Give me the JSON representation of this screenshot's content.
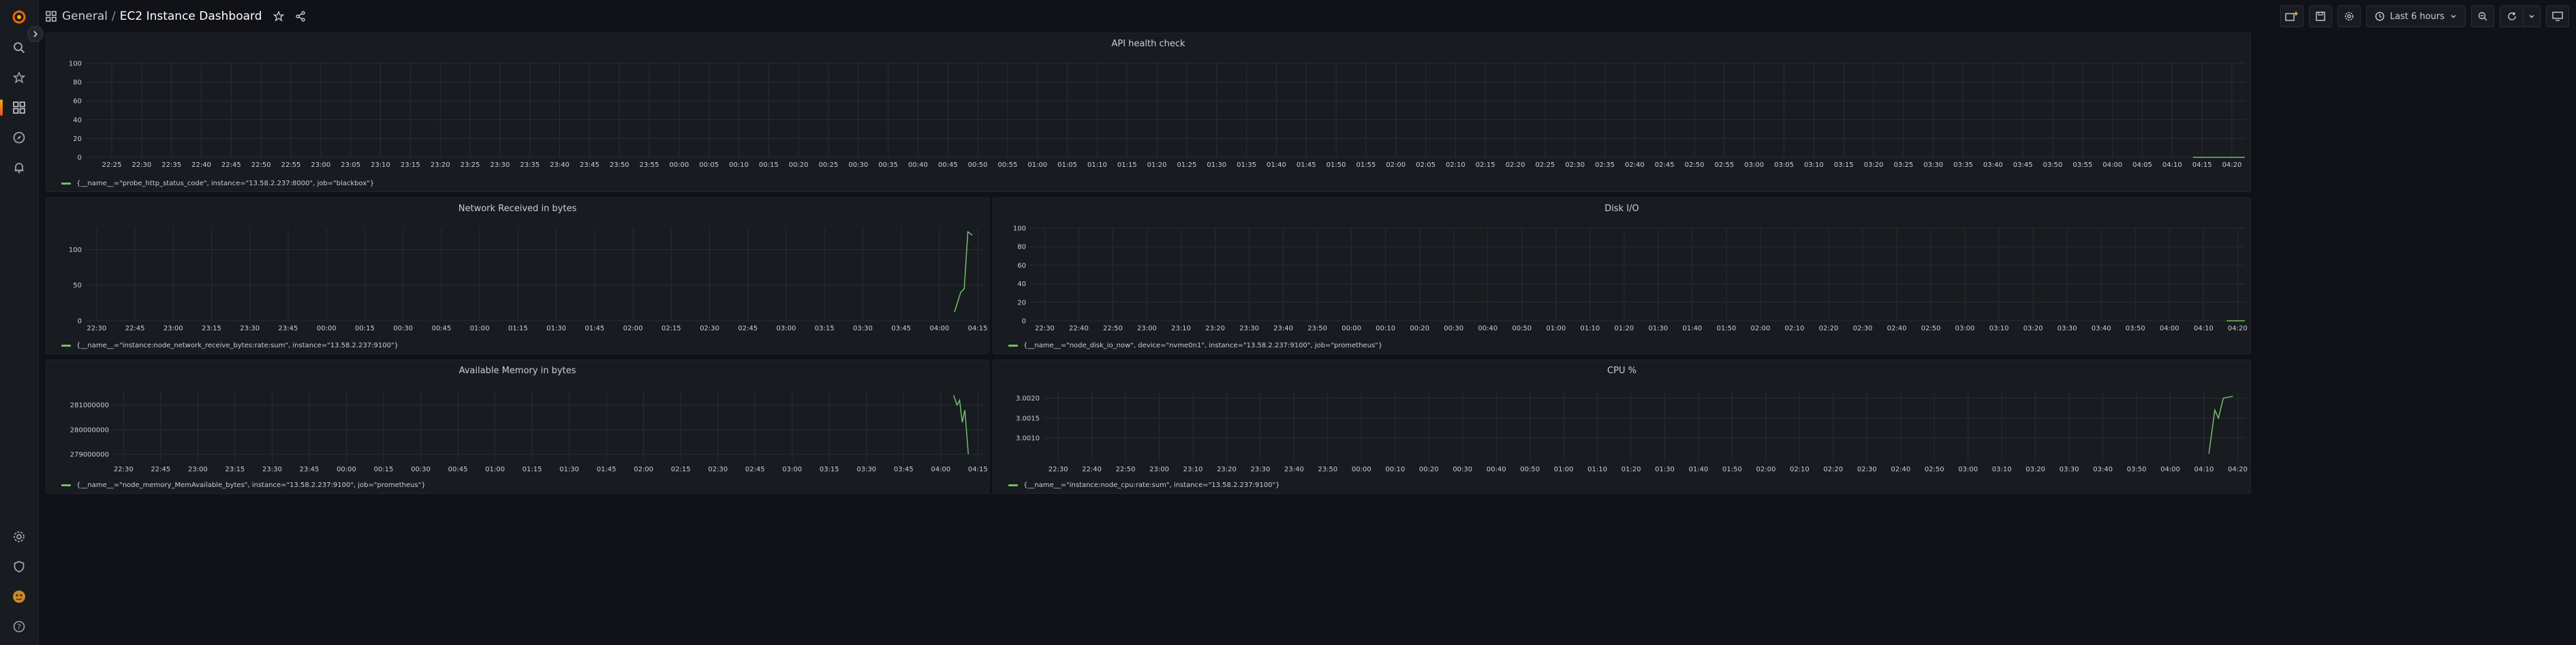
{
  "sidebar": {
    "items": [
      {
        "name": "grafana-logo-icon"
      },
      {
        "name": "search-icon"
      },
      {
        "name": "starred-icon"
      },
      {
        "name": "dashboards-icon"
      },
      {
        "name": "explore-icon"
      },
      {
        "name": "alerting-icon"
      },
      {
        "name": "configuration-icon"
      },
      {
        "name": "server-admin-icon"
      },
      {
        "name": "profile-avatar-icon"
      },
      {
        "name": "help-icon"
      }
    ]
  },
  "breadcrumb": {
    "folder": "General",
    "separator": "/",
    "dashboard": "EC2 Instance Dashboard"
  },
  "toolbar": {
    "time_range": "Last 6 hours"
  },
  "panels": {
    "api": {
      "title": "API health check",
      "legend": "{__name__=\"probe_http_status_code\", instance=\"13.58.2.237:8000\", job=\"blackbox\"}"
    },
    "network": {
      "title": "Network Received in bytes",
      "legend": "{__name__=\"instance:node_network_receive_bytes:rate:sum\", instance=\"13.58.2.237:9100\"}"
    },
    "disk": {
      "title": "Disk I/O",
      "legend": "{__name__=\"node_disk_io_now\", device=\"nvme0n1\", instance=\"13.58.2.237:9100\", job=\"prometheus\"}"
    },
    "memory": {
      "title": "Available Memory in bytes",
      "legend": "{__name__=\"node_memory_MemAvailable_bytes\", instance=\"13.58.2.237:9100\", job=\"prometheus\"}"
    },
    "cpu": {
      "title": "CPU %",
      "legend": "{__name__=\"instance:node_cpu:rate:sum\", instance=\"13.58.2.237:9100\"}"
    }
  },
  "chart_data": [
    {
      "id": "api",
      "type": "line",
      "title": "API health check",
      "yticks": [
        "100",
        "80",
        "60",
        "40",
        "20",
        "0"
      ],
      "ylim": [
        0,
        100
      ],
      "xticks": [
        "22:25",
        "22:30",
        "22:35",
        "22:40",
        "22:45",
        "22:50",
        "22:55",
        "23:00",
        "23:05",
        "23:10",
        "23:15",
        "23:20",
        "23:25",
        "23:30",
        "23:35",
        "23:40",
        "23:45",
        "23:50",
        "23:55",
        "00:00",
        "00:05",
        "00:10",
        "00:15",
        "00:20",
        "00:25",
        "00:30",
        "00:35",
        "00:40",
        "00:45",
        "00:50",
        "00:55",
        "01:00",
        "01:05",
        "01:10",
        "01:15",
        "01:20",
        "01:25",
        "01:30",
        "01:35",
        "01:40",
        "01:45",
        "01:50",
        "01:55",
        "02:00",
        "02:05",
        "02:10",
        "02:15",
        "02:20",
        "02:25",
        "02:30",
        "02:35",
        "02:40",
        "02:45",
        "02:50",
        "02:55",
        "03:00",
        "03:05",
        "03:10",
        "03:15",
        "03:20",
        "03:25",
        "03:30",
        "03:35",
        "03:40",
        "03:45",
        "03:50",
        "03:55",
        "04:00",
        "04:05",
        "04:10",
        "04:15",
        "04:20"
      ],
      "series": [
        {
          "color": "#73bf69",
          "points": [
            [
              0.976,
              0.0
            ],
            [
              1.0,
              0.0
            ]
          ]
        }
      ]
    },
    {
      "id": "network",
      "type": "line",
      "title": "Network Received in bytes",
      "yticks": [
        "100",
        "50",
        "0"
      ],
      "ylim": [
        0,
        130
      ],
      "xticks": [
        "22:30",
        "22:45",
        "23:00",
        "23:15",
        "23:30",
        "23:45",
        "00:00",
        "00:15",
        "00:30",
        "00:45",
        "01:00",
        "01:15",
        "01:30",
        "01:45",
        "02:00",
        "02:15",
        "02:30",
        "02:45",
        "03:00",
        "03:15",
        "03:30",
        "03:45",
        "04:00",
        "04:15"
      ],
      "series": [
        {
          "color": "#73bf69",
          "points": [
            [
              0.968,
              12
            ],
            [
              0.975,
              40
            ],
            [
              0.979,
              45
            ],
            [
              0.983,
              125
            ],
            [
              0.988,
              120
            ]
          ]
        }
      ]
    },
    {
      "id": "disk",
      "type": "line",
      "title": "Disk I/O",
      "yticks": [
        "100",
        "80",
        "60",
        "40",
        "20",
        "0"
      ],
      "ylim": [
        0,
        100
      ],
      "xticks": [
        "22:30",
        "22:40",
        "22:50",
        "23:00",
        "23:10",
        "23:20",
        "23:30",
        "23:40",
        "23:50",
        "00:00",
        "00:10",
        "00:20",
        "00:30",
        "00:40",
        "00:50",
        "01:00",
        "01:10",
        "01:20",
        "01:30",
        "01:40",
        "01:50",
        "02:00",
        "02:10",
        "02:20",
        "02:30",
        "02:40",
        "02:50",
        "03:00",
        "03:10",
        "03:20",
        "03:30",
        "03:40",
        "03:50",
        "04:00",
        "04:10",
        "04:20"
      ],
      "series": [
        {
          "color": "#73bf69",
          "points": [
            [
              0.985,
              0
            ],
            [
              1.0,
              0
            ]
          ]
        }
      ]
    },
    {
      "id": "memory",
      "type": "line",
      "title": "Available Memory in bytes",
      "yticks": [
        "281000000",
        "280000000",
        "279000000"
      ],
      "ylim": [
        278700000,
        281600000
      ],
      "xticks": [
        "22:30",
        "22:45",
        "23:00",
        "23:15",
        "23:30",
        "23:45",
        "00:00",
        "00:15",
        "00:30",
        "00:45",
        "01:00",
        "01:15",
        "01:30",
        "01:45",
        "02:00",
        "02:15",
        "02:30",
        "02:45",
        "03:00",
        "03:15",
        "03:30",
        "03:45",
        "04:00",
        "04:15"
      ],
      "series": [
        {
          "color": "#73bf69",
          "points": [
            [
              0.966,
              281400000
            ],
            [
              0.97,
              281000000
            ],
            [
              0.973,
              281200000
            ],
            [
              0.976,
              280300000
            ],
            [
              0.979,
              280800000
            ],
            [
              0.983,
              279000000
            ]
          ]
        }
      ]
    },
    {
      "id": "cpu",
      "type": "line",
      "title": "CPU %",
      "yticks": [
        "3.0020",
        "3.0015",
        "3.0010"
      ],
      "ylim": [
        3.0004,
        3.0022
      ],
      "xticks": [
        "22:30",
        "22:40",
        "22:50",
        "23:00",
        "23:10",
        "23:20",
        "23:30",
        "23:40",
        "23:50",
        "00:00",
        "00:10",
        "00:20",
        "00:30",
        "00:40",
        "00:50",
        "01:00",
        "01:10",
        "01:20",
        "01:30",
        "01:40",
        "01:50",
        "02:00",
        "02:10",
        "02:20",
        "02:30",
        "02:40",
        "02:50",
        "03:00",
        "03:10",
        "03:20",
        "03:30",
        "03:40",
        "03:50",
        "04:00",
        "04:10",
        "04:20"
      ],
      "series": [
        {
          "color": "#73bf69",
          "points": [
            [
              0.97,
              3.0006
            ],
            [
              0.975,
              3.0017
            ],
            [
              0.978,
              3.0015
            ],
            [
              0.982,
              3.002
            ],
            [
              0.99,
              3.00205
            ]
          ]
        }
      ]
    }
  ]
}
